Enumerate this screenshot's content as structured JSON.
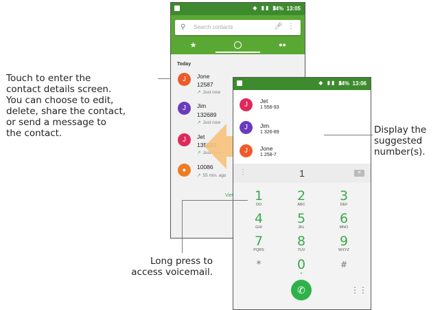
{
  "callouts": {
    "details_lines": [
      "Touch to enter the",
      "contact details screen.",
      "You can choose to edit,",
      "delete, share the contact,",
      "or send a message to",
      "the contact."
    ],
    "suggested_lines": [
      "Display the",
      "suggested",
      "number(s)."
    ],
    "voicemail_lines": [
      "Long press to",
      "access voicemail."
    ]
  },
  "phone1": {
    "status": {
      "battery": "34%",
      "time": "13:05"
    },
    "search_placeholder": "Search contacts",
    "today_label": "Today",
    "entries": [
      {
        "initial": "J",
        "name": "Jone",
        "number": "12587",
        "time": "Just now",
        "color": "#ef5a2b"
      },
      {
        "initial": "J",
        "name": "Jim",
        "number": "132689",
        "time": "Just now",
        "color": "#6a3bbd"
      },
      {
        "initial": "J",
        "name": "Jet",
        "number": "135693",
        "time": "Just now",
        "color": "#e0285a"
      },
      {
        "initial": "",
        "name": "",
        "number": "10086",
        "time": "55 min. ago",
        "color": "#ef7c22"
      }
    ],
    "view_full": "View full"
  },
  "phone2": {
    "status": {
      "battery": "34%",
      "time": "13:06"
    },
    "suggestions": [
      {
        "initial": "J",
        "name": "Jet",
        "number": "1 556-93",
        "color": "#e0285a"
      },
      {
        "initial": "J",
        "name": "Jim",
        "number": "1 326-89",
        "color": "#6a3bbd"
      },
      {
        "initial": "J",
        "name": "Jone",
        "number": "1 258-7",
        "color": "#ef5a2b"
      }
    ],
    "typed": "1",
    "keys": [
      {
        "digit": "1",
        "letters": "OO"
      },
      {
        "digit": "2",
        "letters": "ABC"
      },
      {
        "digit": "3",
        "letters": "DEF"
      },
      {
        "digit": "4",
        "letters": "GHI"
      },
      {
        "digit": "5",
        "letters": "JKL"
      },
      {
        "digit": "6",
        "letters": "MNO"
      },
      {
        "digit": "7",
        "letters": "PQRS"
      },
      {
        "digit": "8",
        "letters": "TUV"
      },
      {
        "digit": "9",
        "letters": "WXYZ"
      },
      {
        "digit": "*",
        "letters": ""
      },
      {
        "digit": "0",
        "letters": "+"
      },
      {
        "digit": "#",
        "letters": ""
      }
    ]
  },
  "colors": {
    "accent": "#3aa94a",
    "header": "#5aa834",
    "statusbar": "#3d8b2e"
  }
}
